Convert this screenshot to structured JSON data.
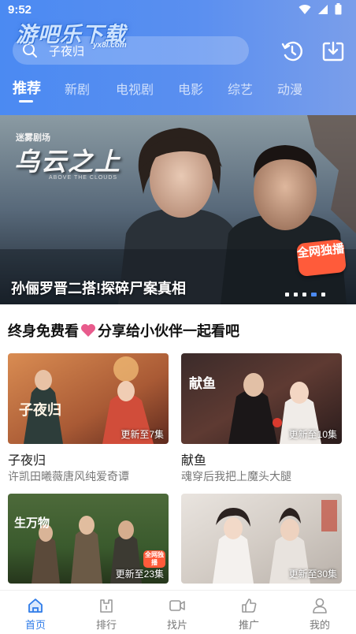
{
  "status_bar": {
    "time": "9:52"
  },
  "watermark": {
    "text": "游吧乐下载",
    "url": "yx8l.com"
  },
  "search": {
    "value": "子夜归"
  },
  "header": {
    "tabs": [
      {
        "label": "推荐",
        "active": true
      },
      {
        "label": "新剧",
        "active": false
      },
      {
        "label": "电视剧",
        "active": false
      },
      {
        "label": "电影",
        "active": false
      },
      {
        "label": "综艺",
        "active": false
      },
      {
        "label": "动漫",
        "active": false
      }
    ],
    "history_icon": "history-refresh-icon",
    "download_icon": "download-tray-icon"
  },
  "banner": {
    "logo_text": "迷雾剧场",
    "title_art": "乌云之上",
    "subtitle_art": "ABOVE THE CLOUDS",
    "badge": "全网独播",
    "caption": "孙俪罗晋二搭!探碎尸案真相",
    "dots_count": 5,
    "active_dot": 4
  },
  "section": {
    "title_left": "终身免费看",
    "title_right": "分享给小伙伴一起看吧",
    "heart_color": "#e85b8c"
  },
  "cards": [
    {
      "title": "子夜归",
      "subtitle": "许凯田曦薇唐风纯爱奇谭",
      "badge": "更新至7集",
      "art": "子夜归"
    },
    {
      "title": "献鱼",
      "subtitle": "魂穿后我把上魔头大腿",
      "badge": "更新至10集",
      "art": "献鱼"
    },
    {
      "title": "",
      "subtitle": "",
      "badge": "更新至23集",
      "art": "生万物",
      "tag": "全网独播"
    },
    {
      "title": "",
      "subtitle": "",
      "badge": "更新至30集",
      "art": ""
    }
  ],
  "bottom_nav": [
    {
      "label": "首页",
      "icon": "home-icon",
      "active": true
    },
    {
      "label": "排行",
      "icon": "ranking-icon",
      "active": false
    },
    {
      "label": "找片",
      "icon": "video-camera-icon",
      "active": false
    },
    {
      "label": "推广",
      "icon": "thumbs-up-icon",
      "active": false
    },
    {
      "label": "我的",
      "icon": "profile-icon",
      "active": false
    }
  ],
  "colors": {
    "accent": "#2e7be8",
    "header_start": "#4b8af2",
    "header_end": "#7a9eea",
    "badge": "#ff5b3a"
  }
}
